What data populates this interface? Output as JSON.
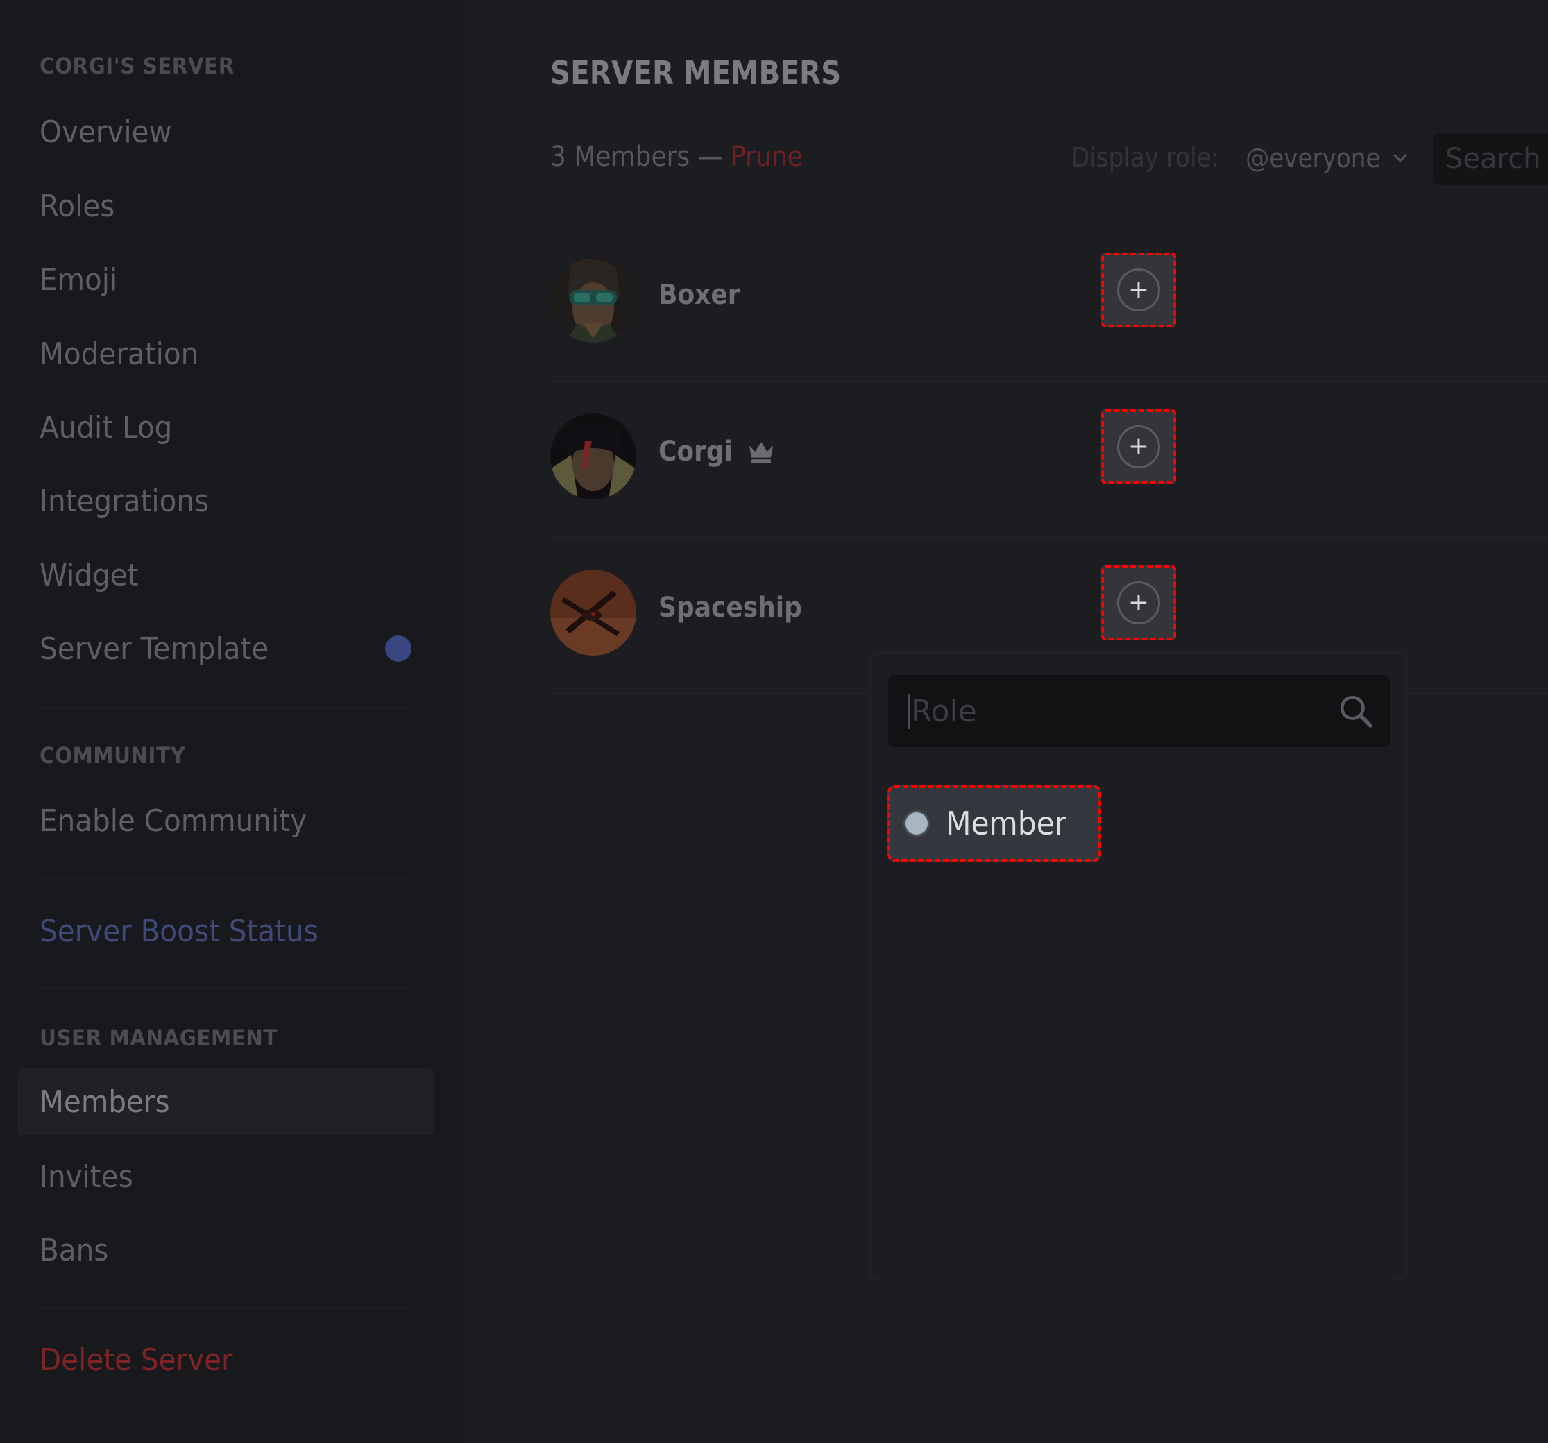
{
  "sidebar": {
    "server_heading": "CORGI'S SERVER",
    "items": [
      {
        "label": "Overview"
      },
      {
        "label": "Roles"
      },
      {
        "label": "Emoji"
      },
      {
        "label": "Moderation"
      },
      {
        "label": "Audit Log"
      },
      {
        "label": "Integrations"
      },
      {
        "label": "Widget"
      },
      {
        "label": "Server Template",
        "badge": "unread-dot"
      }
    ],
    "community_heading": "COMMUNITY",
    "community_items": [
      {
        "label": "Enable Community"
      }
    ],
    "boost_item": {
      "label": "Server Boost Status"
    },
    "user_management_heading": "USER MANAGEMENT",
    "user_management_items": [
      {
        "label": "Members",
        "selected": true
      },
      {
        "label": "Invites"
      },
      {
        "label": "Bans"
      }
    ],
    "delete_item": {
      "label": "Delete Server"
    }
  },
  "main": {
    "title": "SERVER MEMBERS",
    "member_count": "3 Members",
    "separator": " — ",
    "prune_label": "Prune",
    "display_role_label": "Display role:",
    "display_role_value": "@everyone",
    "search_placeholder": "Search",
    "members": [
      {
        "name": "Boxer",
        "owner": false,
        "avatar": "boxer-avatar"
      },
      {
        "name": "Corgi",
        "owner": true,
        "avatar": "corgi-avatar"
      },
      {
        "name": "Spaceship",
        "owner": false,
        "avatar": "spaceship-avatar"
      }
    ],
    "add_role_symbol": "+"
  },
  "role_popup": {
    "search_placeholder": "Role",
    "search_value": "",
    "roles": [
      {
        "label": "Member",
        "color": "#a7b6c1"
      }
    ]
  },
  "colors": {
    "accent_blurple": "#3a4682",
    "danger": "#7e2326",
    "highlight_outline": "#ff0000"
  }
}
